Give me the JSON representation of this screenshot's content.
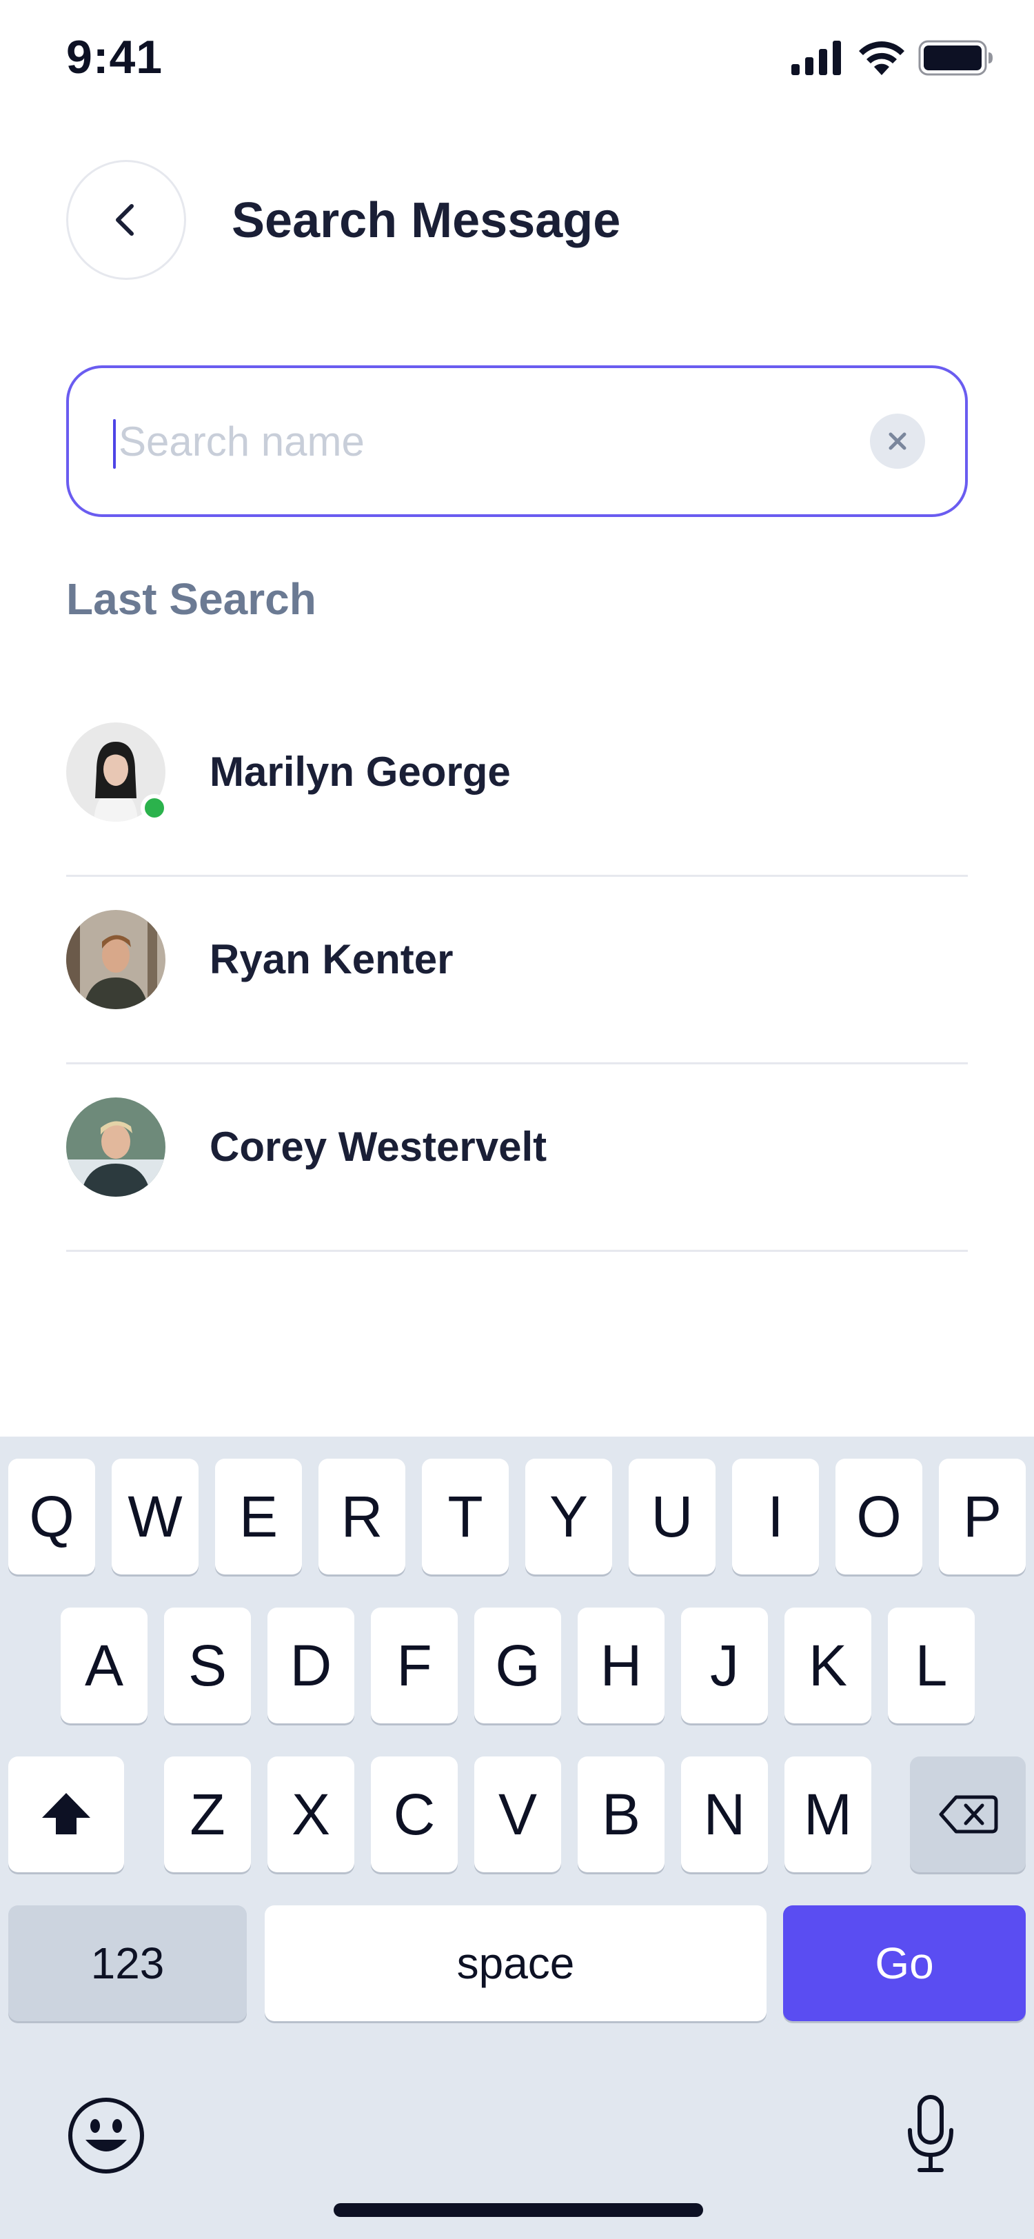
{
  "status_bar": {
    "time": "9:41"
  },
  "header": {
    "title": "Search Message",
    "back_icon": "chevron-left-icon"
  },
  "search": {
    "placeholder": "Search name",
    "value": "",
    "clear_icon": "close-icon"
  },
  "last_search": {
    "label": "Last Search",
    "contacts": [
      {
        "name": "Marilyn George",
        "online": true
      },
      {
        "name": "Ryan Kenter",
        "online": false
      },
      {
        "name": "Corey Westervelt",
        "online": false
      }
    ]
  },
  "keyboard": {
    "row1": [
      "Q",
      "W",
      "E",
      "R",
      "T",
      "Y",
      "U",
      "I",
      "O",
      "P"
    ],
    "row2": [
      "A",
      "S",
      "D",
      "F",
      "G",
      "H",
      "J",
      "K",
      "L"
    ],
    "row3": [
      "Z",
      "X",
      "C",
      "V",
      "B",
      "N",
      "M"
    ],
    "numbers_label": "123",
    "space_label": "space",
    "go_label": "Go",
    "shift_icon": "shift-icon",
    "backspace_icon": "backspace-icon",
    "emoji_icon": "emoji-icon",
    "mic_icon": "microphone-icon"
  },
  "colors": {
    "accent": "#5a4df2",
    "search_border": "#6a5cf0",
    "online": "#2bb24c",
    "keyboard_bg": "#e1e7ef"
  }
}
